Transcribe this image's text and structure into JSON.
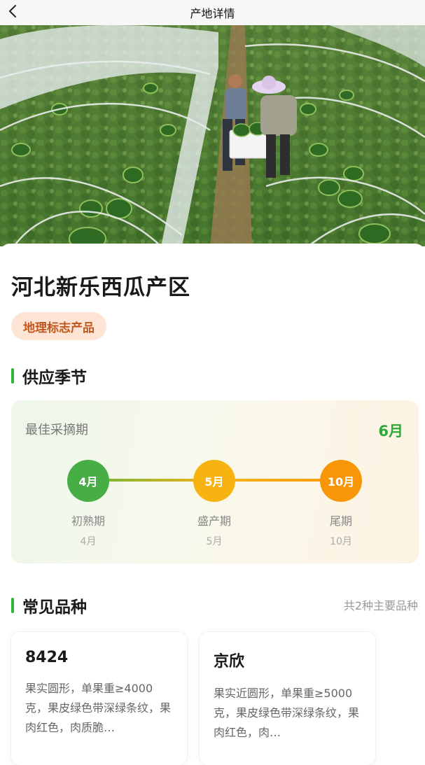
{
  "nav": {
    "title": "产地详情",
    "back_icon": "chevron-left-icon"
  },
  "hero": {
    "image": "watermelon-greenhouse-photo"
  },
  "place": {
    "name": "河北新乐西瓜产区",
    "tag": "地理标志产品"
  },
  "season": {
    "title": "供应季节",
    "best_label": "最佳采摘期",
    "best_month": "6月",
    "stages": [
      {
        "dot": "4月",
        "name": "初熟期",
        "sub": "4月",
        "color": "#47ad45"
      },
      {
        "dot": "5月",
        "name": "盛产期",
        "sub": "5月",
        "color": "#f7b310"
      },
      {
        "dot": "10月",
        "name": "尾期",
        "sub": "10月",
        "color": "#f99608"
      }
    ]
  },
  "varieties": {
    "title": "常见品种",
    "count_text": "共2种主要品种",
    "items": [
      {
        "name": "8424",
        "desc": "果实圆形，单果重≥4000克，果皮绿色带深绿条纹，果肉红色，肉质脆…"
      },
      {
        "name": "京欣",
        "desc": "果实近圆形，单果重≥5000克，果皮绿色带深绿条纹，果肉红色，肉…"
      }
    ]
  },
  "colors": {
    "accent_green": "#2fb43c",
    "tag_bg": "#fde4d5",
    "tag_text": "#c2571e"
  }
}
